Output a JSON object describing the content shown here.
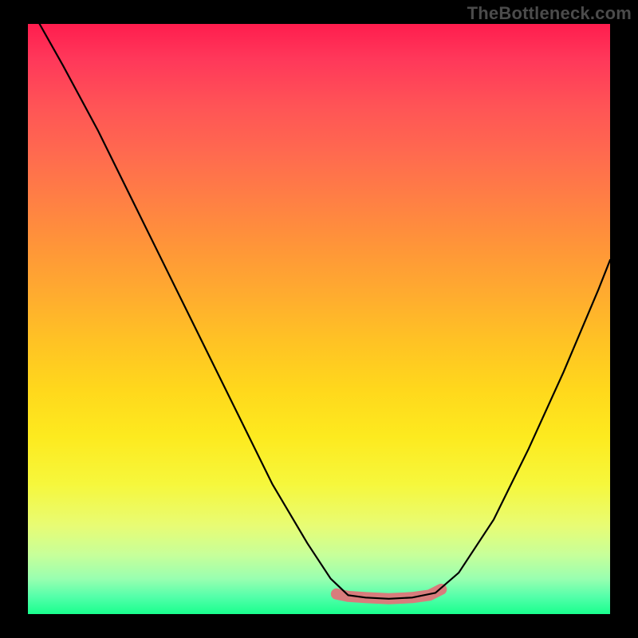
{
  "attribution": "TheBottleneck.com",
  "chart_data": {
    "type": "line",
    "title": "",
    "xlabel": "",
    "ylabel": "",
    "xlim": [
      0,
      100
    ],
    "ylim": [
      0,
      100
    ],
    "curve_main": [
      {
        "x": 2,
        "y": 100
      },
      {
        "x": 6,
        "y": 93
      },
      {
        "x": 12,
        "y": 82
      },
      {
        "x": 18,
        "y": 70
      },
      {
        "x": 24,
        "y": 58
      },
      {
        "x": 30,
        "y": 46
      },
      {
        "x": 36,
        "y": 34
      },
      {
        "x": 42,
        "y": 22
      },
      {
        "x": 48,
        "y": 12
      },
      {
        "x": 52,
        "y": 6
      },
      {
        "x": 55,
        "y": 3.2
      },
      {
        "x": 58,
        "y": 2.8
      },
      {
        "x": 62,
        "y": 2.6
      },
      {
        "x": 66,
        "y": 2.8
      },
      {
        "x": 70,
        "y": 3.6
      },
      {
        "x": 74,
        "y": 7
      },
      {
        "x": 80,
        "y": 16
      },
      {
        "x": 86,
        "y": 28
      },
      {
        "x": 92,
        "y": 41
      },
      {
        "x": 98,
        "y": 55
      },
      {
        "x": 100,
        "y": 60
      }
    ],
    "trough_band": [
      {
        "x": 53,
        "y": 3.4
      },
      {
        "x": 55,
        "y": 3.0
      },
      {
        "x": 58,
        "y": 2.8
      },
      {
        "x": 62,
        "y": 2.6
      },
      {
        "x": 66,
        "y": 2.8
      },
      {
        "x": 69,
        "y": 3.2
      },
      {
        "x": 71,
        "y": 4.2
      }
    ],
    "colors": {
      "curve": "#000000",
      "trough": "#d87c7c",
      "bg_top": "#ff1d4e",
      "bg_bottom": "#19ff8e"
    }
  }
}
